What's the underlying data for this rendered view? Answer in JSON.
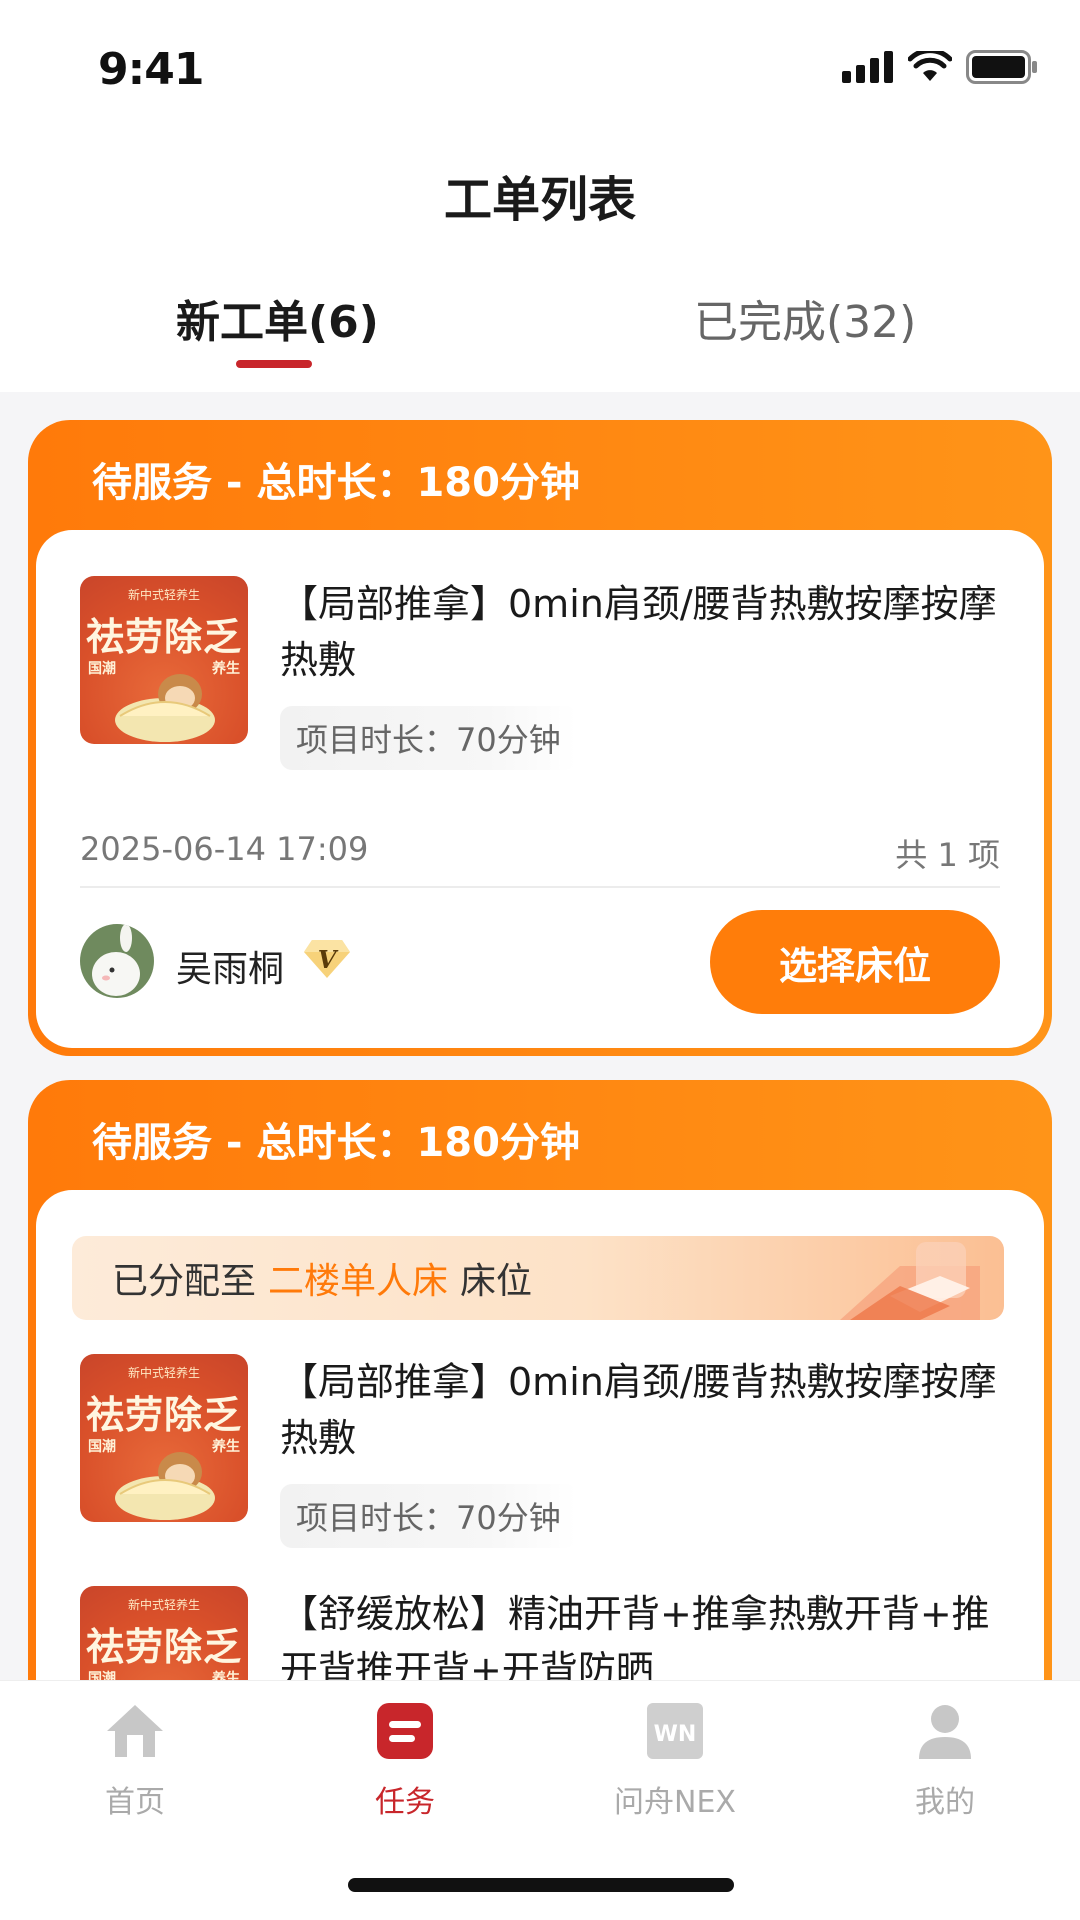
{
  "status_bar": {
    "time": "9:41"
  },
  "header": {
    "title": "工单列表"
  },
  "tabs": [
    {
      "label": "新工单(6)",
      "active": true
    },
    {
      "label": "已完成(32)",
      "active": false
    }
  ],
  "thumbnail": {
    "small_text": "新中式轻养生",
    "big_text": "祛劳除乏",
    "left_text": "国潮",
    "right_text": "养生"
  },
  "orders": [
    {
      "header": "待服务  -  总时长：180分钟",
      "items": [
        {
          "title": "【局部推拿】0min肩颈/腰背热敷按摩按摩热敷",
          "duration": "项目时长：70分钟"
        }
      ],
      "time": "2025-06-14 17:09",
      "count": "共 1 项",
      "user": {
        "name": "吴雨桐",
        "vip": "V"
      },
      "action": "选择床位"
    },
    {
      "header": "待服务  -  总时长：180分钟",
      "assigned": {
        "prefix": "已分配至",
        "bed": "二楼单人床",
        "suffix": "床位"
      },
      "items": [
        {
          "title": "【局部推拿】0min肩颈/腰背热敷按摩按摩热敷",
          "duration": "项目时长：70分钟"
        },
        {
          "title": "【舒缓放松】精油开背+推拿热敷开背+推开背推开背+开背防晒"
        }
      ]
    }
  ],
  "tabbar": [
    {
      "label": "首页",
      "icon": "home-icon",
      "active": false
    },
    {
      "label": "任务",
      "icon": "task-icon",
      "active": true
    },
    {
      "label": "问舟NEX",
      "icon": "wn-logo-icon",
      "active": false
    },
    {
      "label": "我的",
      "icon": "profile-icon",
      "active": false
    }
  ],
  "colors": {
    "accent": "#ff7d0a",
    "brand_red": "#c8262b"
  }
}
